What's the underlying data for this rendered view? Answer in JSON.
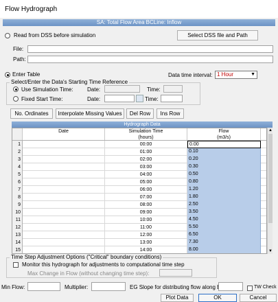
{
  "window": {
    "title": "Flow Hydrograph"
  },
  "sa_header": "SA: Total Flow Area BCLine: Inflow",
  "dss": {
    "read_label": "Read from DSS before simulation",
    "select_button": "Select DSS file and Path",
    "file_label": "File:",
    "path_label": "Path:",
    "file_value": "",
    "path_value": ""
  },
  "enter_table": {
    "label": "Enter Table",
    "interval_label": "Data time interval:",
    "interval_value": "1 Hour"
  },
  "time_ref": {
    "legend": "Select/Enter the Data's Starting Time Reference",
    "use_sim_label": "Use Simulation Time:",
    "fixed_label": "Fixed Start Time:",
    "date_label": "Date:",
    "time_label": "Time:"
  },
  "buttons": {
    "no_ordinates": "No. Ordinates",
    "interpolate": "Interpolate Missing Values",
    "del_row": "Del Row",
    "ins_row": "Ins Row",
    "plot_data": "Plot Data",
    "ok": "OK",
    "cancel": "Cancel"
  },
  "hydrograph": {
    "title": "Hydrograph Data",
    "col_date": "Date",
    "col_sim_time": "Simulation Time",
    "col_sim_time_unit": "(hours)",
    "col_flow": "Flow",
    "col_flow_unit": "(m3/s)",
    "rows": [
      {
        "num": "1",
        "time": "00:00",
        "flow": "0.00"
      },
      {
        "num": "2",
        "time": "01:00",
        "flow": "0.10"
      },
      {
        "num": "3",
        "time": "02:00",
        "flow": "0.20"
      },
      {
        "num": "4",
        "time": "03:00",
        "flow": "0.30"
      },
      {
        "num": "5",
        "time": "04:00",
        "flow": "0.50"
      },
      {
        "num": "6",
        "time": "05:00",
        "flow": "0.80"
      },
      {
        "num": "7",
        "time": "06:00",
        "flow": "1.20"
      },
      {
        "num": "8",
        "time": "07:00",
        "flow": "1.80"
      },
      {
        "num": "9",
        "time": "08:00",
        "flow": "2.50"
      },
      {
        "num": "10",
        "time": "09:00",
        "flow": "3.50"
      },
      {
        "num": "11",
        "time": "10:00",
        "flow": "4.50"
      },
      {
        "num": "12",
        "time": "11:00",
        "flow": "5.50"
      },
      {
        "num": "13",
        "time": "12:00",
        "flow": "6.50"
      },
      {
        "num": "14",
        "time": "13:00",
        "flow": "7.30"
      },
      {
        "num": "15",
        "time": "14:00",
        "flow": "8.00"
      }
    ]
  },
  "tsa": {
    "legend": "Time Step Adjustment Options (\"Critical\" boundary conditions)",
    "monitor_label": "Monitor this hydrograph for adjustments to computational time step",
    "max_change_label": "Max Change in Flow (without changing time step):"
  },
  "bottom": {
    "min_flow_label": "Min Flow:",
    "multiplier_label": "Multiplier:",
    "eg_slope_label": "EG Slope for distributing flow along BC Line:",
    "tw_check_label": "TW Check"
  }
}
